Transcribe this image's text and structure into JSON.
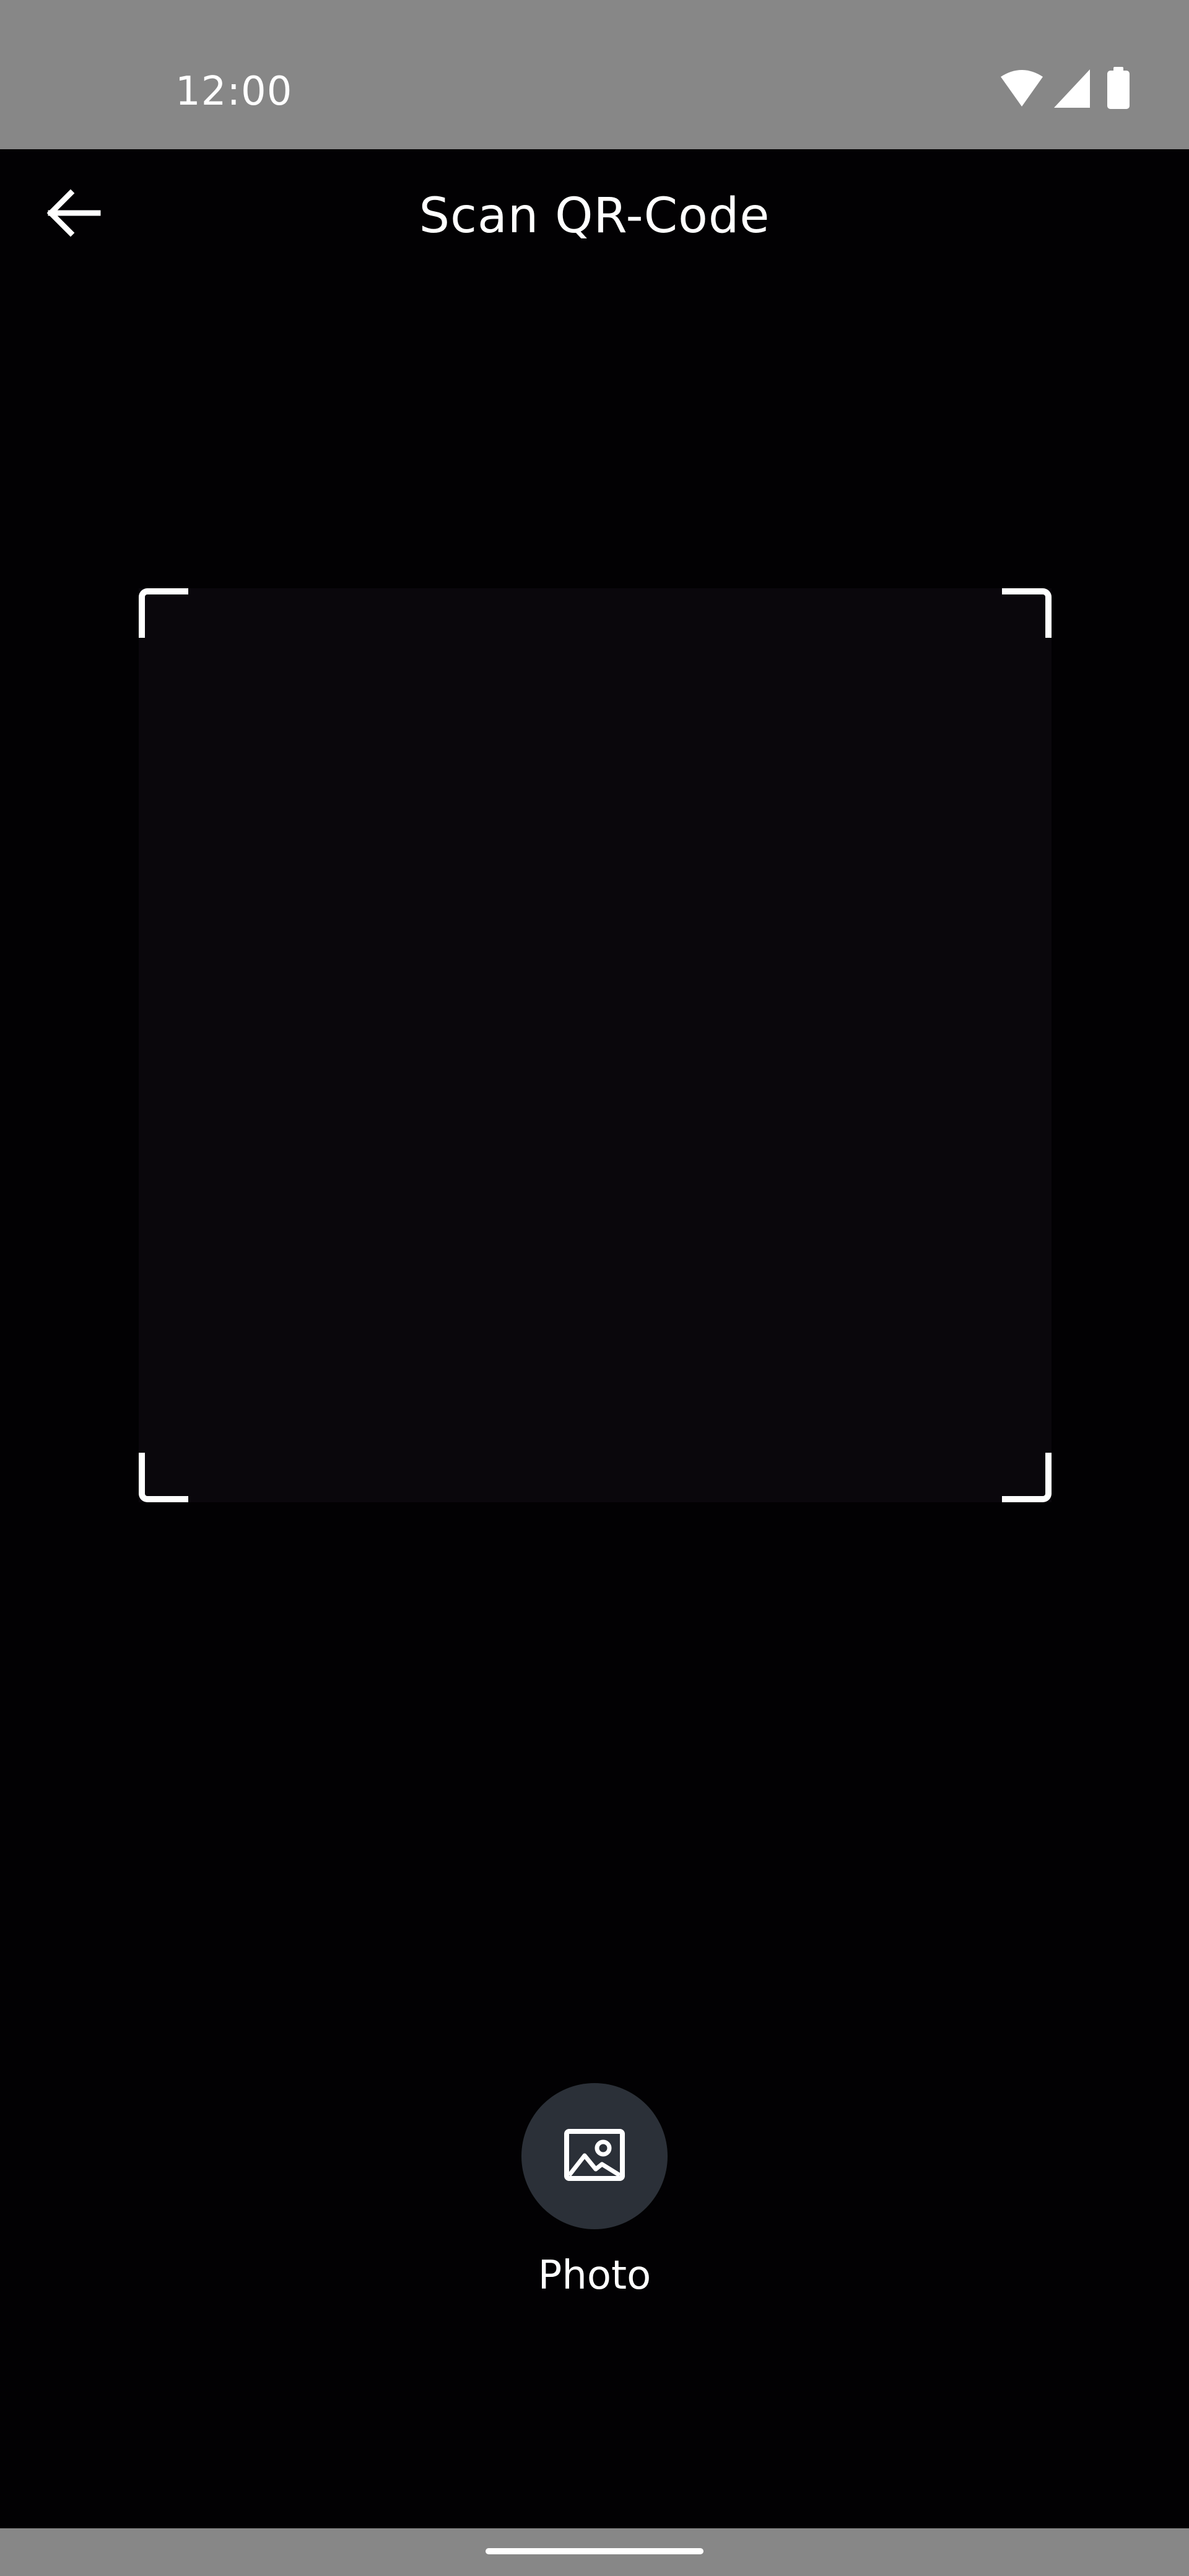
{
  "status_bar": {
    "time": "12:00",
    "icons": [
      "wifi-icon",
      "signal-icon",
      "battery-icon"
    ],
    "background_color": "#878787"
  },
  "app_bar": {
    "title": "Scan QR-Code",
    "back_icon": "arrow-back-icon"
  },
  "scanner": {
    "frame_color": "#ffffff",
    "viewfinder_color": "#0a070c"
  },
  "photo_action": {
    "label": "Photo",
    "icon": "image-icon",
    "button_color": "#2b3038"
  },
  "navigation_bar": {
    "handle": "home-handle",
    "background_color": "#878787"
  }
}
